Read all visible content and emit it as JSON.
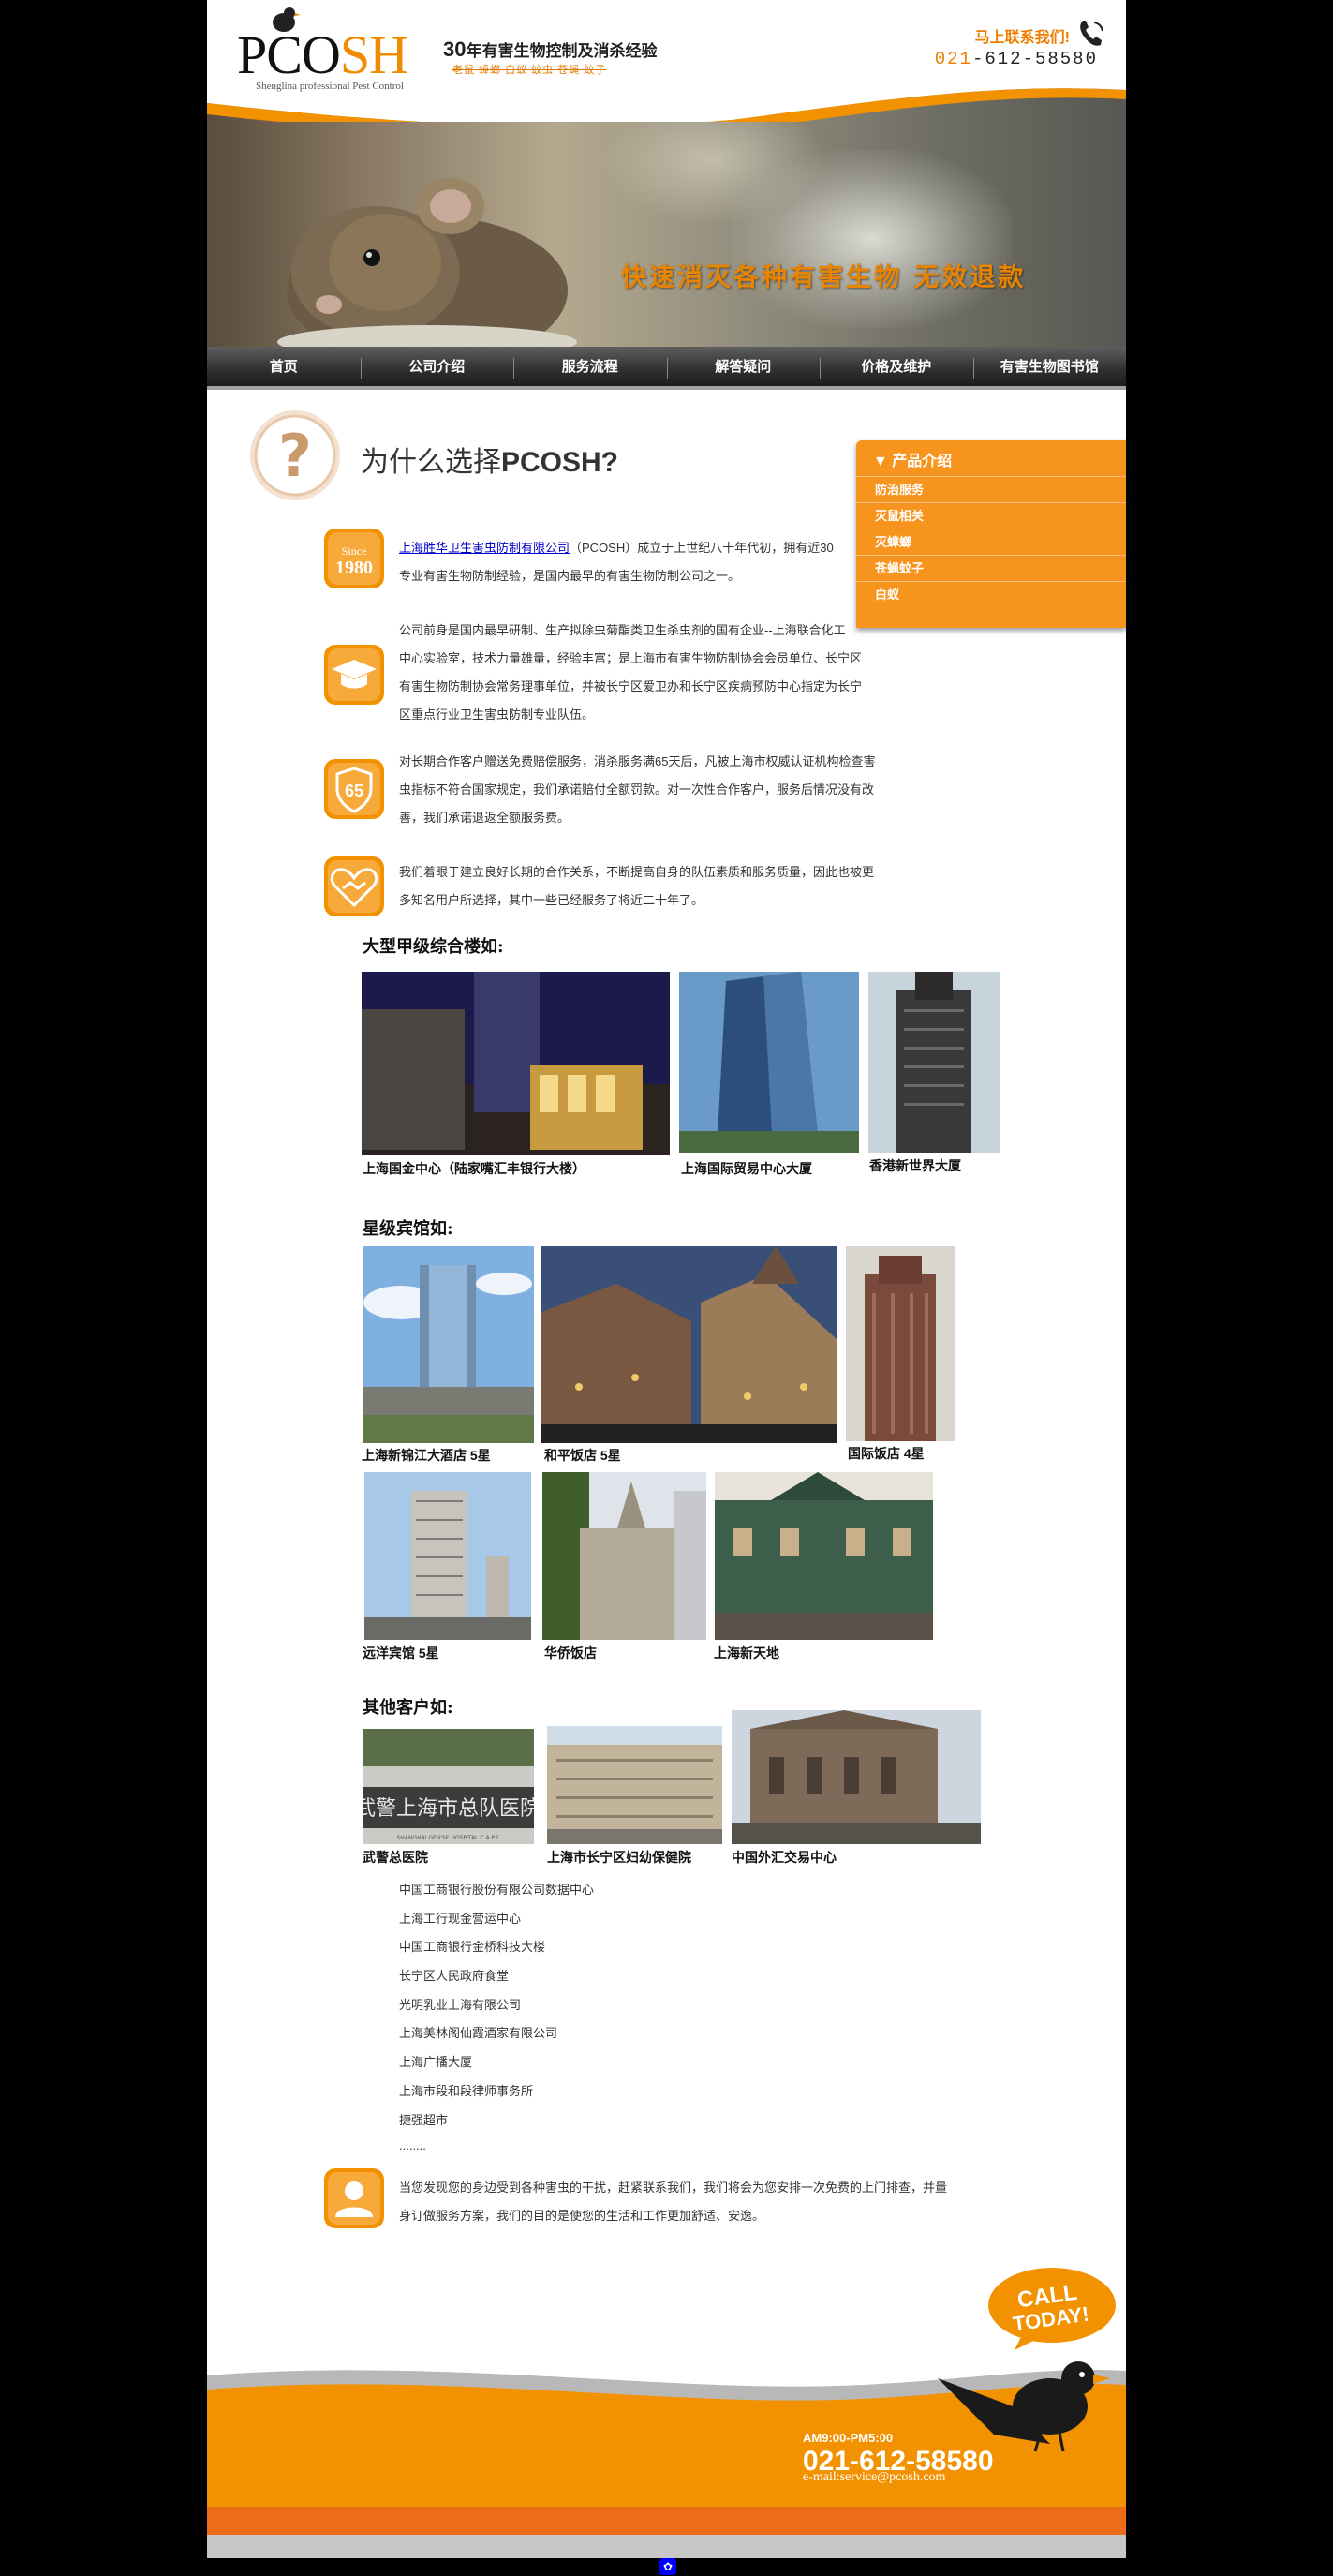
{
  "header": {
    "logo_main": "PCO",
    "logo_accent": "SH",
    "logo_sub": "Shenglina professional Pest Control",
    "tagline_num": "30",
    "tagline_text": "年有害生物控制及消杀经验",
    "tagline_sub": "老鼠 蟑螂 白蚁 蚊虫 苍蝇 蚊子",
    "contact_label": "马上联系我们!",
    "contact_phone_prefix": "021",
    "contact_phone_rest": "-612-58580",
    "slogan": "快速消灭各种有害生物 无效退款"
  },
  "nav": {
    "items": [
      "首页",
      "公司介绍",
      "服务流程",
      "解答疑问",
      "价格及维护",
      "有害生物图书馆"
    ]
  },
  "main": {
    "title_prefix": "为什么选择",
    "title_brand": "PCOSH?"
  },
  "product_box": {
    "title": "▼ 产品介绍",
    "items": [
      "防治服务",
      "灭鼠相关",
      "灭蟑螂",
      "苍蝇蚊子",
      "白蚁"
    ]
  },
  "features": [
    {
      "icon_text_top": "Since",
      "icon_text_bottom": "1980",
      "link": "上海胜华卫生害虫防制有限公司",
      "line1_rest": "（PCOSH）成立于上世纪八十年代初，拥有近30",
      "line2": "专业有害生物防制经验，是国内最早的有害生物防制公司之一。"
    },
    {
      "lines": [
        "公司前身是国内最早研制、生产拟除虫菊酯类卫生杀虫剂的国有企业--上海联合化工",
        "中心实验室，技术力量雄量，经验丰富；是上海市有害生物防制协会会员单位、长宁区",
        "有害生物防制协会常务理事单位，并被长宁区爱卫办和长宁区疾病预防中心指定为长宁",
        "区重点行业卫生害虫防制专业队伍。"
      ]
    },
    {
      "icon_text": "65",
      "lines": [
        "对长期合作客户赠送免费赔偿服务，消杀服务满65天后，凡被上海市权威认证机构检查害",
        "虫指标不符合国家规定，我们承诺赔付全额罚款。对一次性合作客户，服务后情况没有改",
        "善，我们承诺退返全额服务费。"
      ]
    },
    {
      "lines": [
        "我们着眼于建立良好长期的合作关系，不断提高自身的队伍素质和服务质量，因此也被更",
        "多知名用户所选择，其中一些已经服务了将近二十年了。"
      ]
    }
  ],
  "office_section": {
    "title": "大型甲级综合楼如:",
    "captions": [
      "上海国金中心（陆家嘴汇丰银行大楼）",
      "上海国际贸易中心大厦",
      "香港新世界大厦"
    ]
  },
  "hotel_section": {
    "title": "星级宾馆如:",
    "captions": [
      "上海新锦江大酒店 5星",
      "和平饭店 5星",
      "国际饭店 4星",
      "远洋宾馆 5星",
      "华侨饭店",
      "上海新天地"
    ]
  },
  "other_section": {
    "title": "其他客户如:",
    "captions": [
      "武警总医院",
      "上海市长宁区妇幼保健院",
      "中国外汇交易中心"
    ],
    "hospital_sign": "武警上海市总队医院",
    "hospital_sign_en": "SHANGHAI GEN'SE HOSPITAL C.A.P.F",
    "list": [
      "中国工商银行股份有限公司数据中心",
      "上海工行现金营运中心",
      "中国工商银行金桥科技大楼",
      "长宁区人民政府食堂",
      "光明乳业上海有限公司",
      "上海美林阁仙霞酒家有限公司",
      "上海广播大厦",
      "上海市段和段律师事务所",
      "捷强超市",
      "........"
    ]
  },
  "closing": {
    "lines": [
      "当您发现您的身边受到各种害虫的干扰，赶紧联系我们，我们将会为您安排一次免费的上门排查，并量",
      "身订做服务方案，我们的目的是使您的生活和工作更加舒适、安逸。"
    ]
  },
  "footer": {
    "call_line1": "CALL",
    "call_line2": "TODAY!",
    "hours": "AM9:00-PM5:00",
    "phone": "021-612-58580",
    "email": "e-mail:service@pcosh.com"
  },
  "colors": {
    "accent": "#f7941d",
    "nav_bg": "#2f2f2f",
    "link": "#0000cc"
  }
}
